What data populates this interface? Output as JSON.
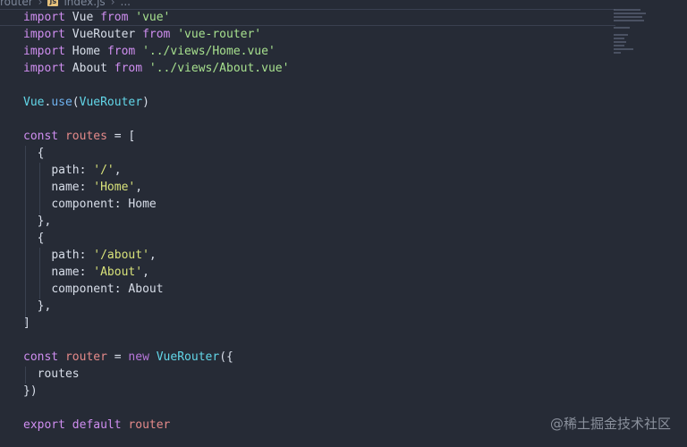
{
  "breadcrumb": {
    "folder": "router",
    "file": "index.js",
    "more": "..."
  },
  "code": {
    "l1": {
      "kw1": "import",
      "name": "Vue",
      "kw2": "from",
      "src": "'vue'"
    },
    "l2": {
      "kw1": "import",
      "name": "VueRouter",
      "kw2": "from",
      "src": "'vue-router'"
    },
    "l3": {
      "kw1": "import",
      "name": "Home",
      "kw2": "from",
      "src": "'../views/Home.vue'"
    },
    "l4": {
      "kw1": "import",
      "name": "About",
      "kw2": "from",
      "src": "'../views/About.vue'"
    },
    "l6": {
      "obj": "Vue",
      "dot": ".",
      "method": "use",
      "open": "(",
      "arg": "VueRouter",
      "close": ")"
    },
    "l8": {
      "kw": "const",
      "name": "routes",
      "rest": " = ["
    },
    "l9": {
      "text": "  {"
    },
    "l10": {
      "key": "path",
      "colon": ": ",
      "val": "'/'",
      "comma": ","
    },
    "l11": {
      "key": "name",
      "colon": ": ",
      "val": "'Home'",
      "comma": ","
    },
    "l12": {
      "key": "component",
      "colon": ": ",
      "val": "Home"
    },
    "l13": {
      "text": "  },"
    },
    "l14": {
      "text": "  {"
    },
    "l15": {
      "key": "path",
      "colon": ": ",
      "val": "'/about'",
      "comma": ","
    },
    "l16": {
      "key": "name",
      "colon": ": ",
      "val": "'About'",
      "comma": ","
    },
    "l17": {
      "key": "component",
      "colon": ": ",
      "val": "About"
    },
    "l18": {
      "text": "  },"
    },
    "l19": {
      "text": "]"
    },
    "l21": {
      "kw": "const",
      "name": "router",
      "eq": " = ",
      "newkw": "new",
      "cls": "VueRouter",
      "rest": "({"
    },
    "l22": {
      "text": "  routes"
    },
    "l23": {
      "text": "})"
    },
    "l25": {
      "kw1": "export",
      "kw2": "default",
      "name": "router"
    }
  },
  "watermark": "@稀土掘金技术社区",
  "icons": {
    "file_type": "js-file-icon"
  }
}
